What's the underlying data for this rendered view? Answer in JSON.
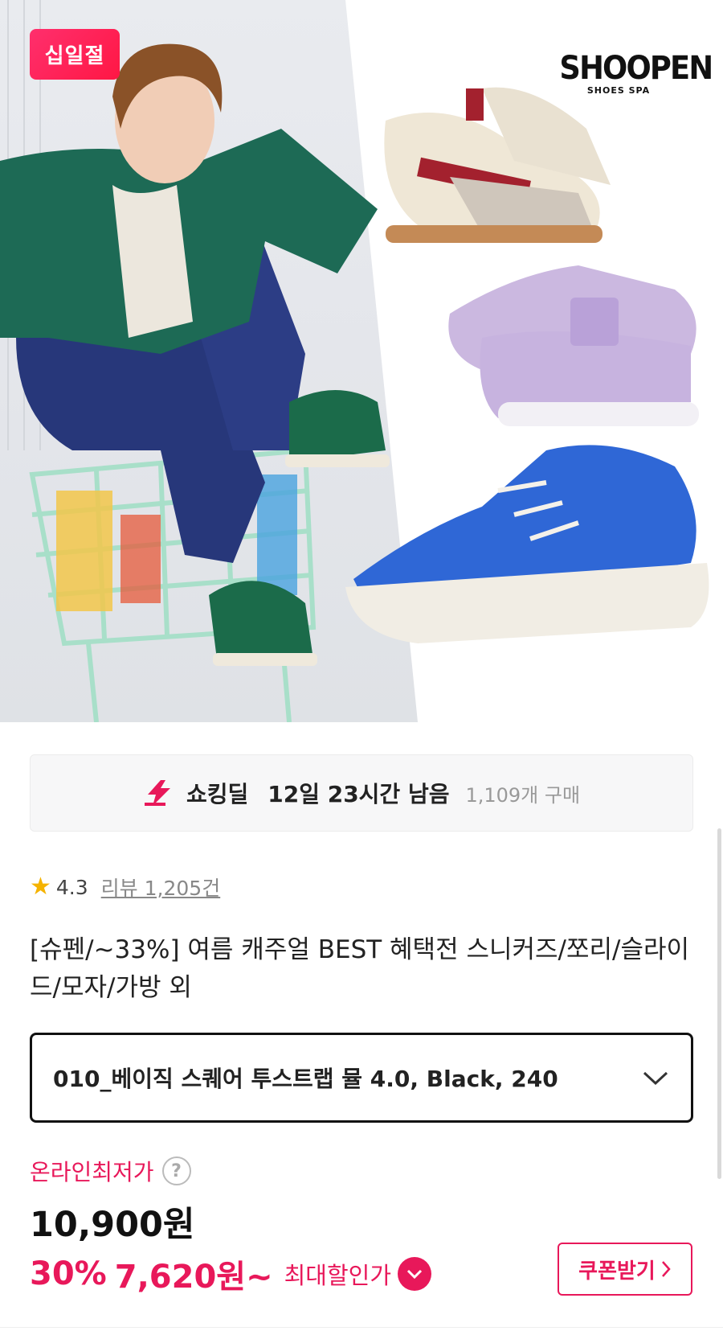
{
  "hero": {
    "badge_label": "십일절",
    "brand_name": "SHOOPEN",
    "brand_sub": "SHOES SPA"
  },
  "deal": {
    "name": "쇼킹딜",
    "time_left": "12일 23시간 남음",
    "purchase_count": "1,109개 구매"
  },
  "rating": {
    "value": "4.3",
    "reviews": "리뷰 1,205건"
  },
  "product": {
    "title": "[슈펜/~33%] 여름 캐주얼 BEST 혜택전 스니커즈/쪼리/슬라이드/모자/가방 외"
  },
  "option": {
    "selected": "010_베이직 스퀘어 투스트랩 뮬 4.0, Black, 240"
  },
  "price": {
    "lowest_label": "온라인최저가",
    "help_glyph": "?",
    "original": "10,900원",
    "discount_rate": "30%",
    "sale_price": "7,620원~",
    "max_discount_label": "최대할인가",
    "coupon_label": "쿠폰받기"
  },
  "colors": {
    "accent": "#e8185a",
    "star": "#f5b301"
  },
  "icons": {
    "deal": "lightning-icon",
    "star": "star-icon",
    "help": "question-circle-icon",
    "dropdown": "chevron-down-icon",
    "coupon_arrow": "chevron-right-icon",
    "max_discount": "chevron-down-circle-icon"
  }
}
